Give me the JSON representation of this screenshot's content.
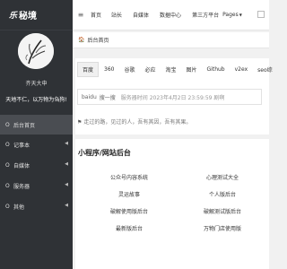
{
  "brand": {
    "icon": "logo-glyph",
    "logo_glyph": "乐",
    "title": "秘境"
  },
  "user": {
    "name": "齐天大申",
    "motto": "天地不仁，以万物为刍狗!"
  },
  "sidebar": {
    "items": [
      {
        "label": "后台首页",
        "icon": "circle-icon",
        "glyph": "O",
        "has_children": false,
        "active": true
      },
      {
        "label": "记事本",
        "icon": "circle-icon",
        "glyph": "O",
        "has_children": true,
        "active": false
      },
      {
        "label": "自媒体",
        "icon": "circle-icon",
        "glyph": "O",
        "has_children": true,
        "active": false
      },
      {
        "label": "服务器",
        "icon": "circle-icon",
        "glyph": "O",
        "has_children": true,
        "active": false
      },
      {
        "label": "其他",
        "icon": "circle-icon",
        "glyph": "O",
        "has_children": true,
        "active": false
      }
    ],
    "chevron_glyph": "◀"
  },
  "topbar": {
    "toggle_glyph": "≡",
    "links": [
      "首页",
      "站长",
      "自媒体",
      "数据中心",
      "第三方平台"
    ],
    "dropdown": "Pages",
    "caret": "▼"
  },
  "breadcrumb": {
    "home_glyph": "🏠",
    "label": "后台首页"
  },
  "search": {
    "engines": [
      "百度",
      "360",
      "谷歌",
      "必应",
      "淘宝",
      "图片",
      "Github",
      "v2ex",
      "seo综"
    ],
    "active_engine": 0,
    "prefix": "baidu",
    "hint": "搜一搜",
    "placeholder": "服务器时间 2023年4月2日 23:59:59 剧啊"
  },
  "notice": {
    "icon_glyph": "⚑",
    "text": "走过的路，见过的人，吾有其因，吾有其果。"
  },
  "miniapp": {
    "title": "小程序/网站后台",
    "items": [
      "公众号内容系统",
      "心理测试大全",
      "灵运故事",
      "个人版后台",
      "破解使用版后台",
      "破解测试版后台",
      "最新版后台",
      "万物门店使用版"
    ]
  },
  "colors": {
    "sidebar_bg": "#2f3236",
    "active_item_bg": "#4a4d52",
    "page_bg": "#f1f1f1",
    "card_bg": "#ffffff"
  }
}
